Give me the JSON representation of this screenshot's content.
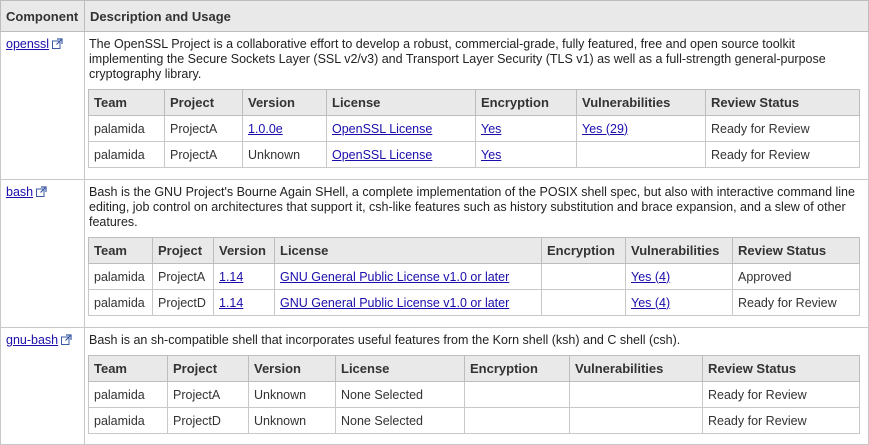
{
  "header": {
    "component": "Component",
    "description": "Description and Usage"
  },
  "inner_headers": [
    "Team",
    "Project",
    "Version",
    "License",
    "Encryption",
    "Vulnerabilities",
    "Review Status"
  ],
  "components": [
    {
      "name": "openssl",
      "description": "The OpenSSL Project is a collaborative effort to develop a robust, commercial-grade, fully featured, free and open source toolkit implementing the Secure Sockets Layer (SSL v2/v3) and Transport Layer Security (TLS v1) as well as a full-strength general-purpose cryptography library.",
      "rows": [
        {
          "team": "palamida",
          "project": "ProjectA",
          "version": "1.0.0e",
          "version_link": true,
          "license": "OpenSSL License",
          "license_link": true,
          "encryption": "Yes",
          "vulnerabilities": "Yes (29)",
          "review_status": "Ready for Review"
        },
        {
          "team": "palamida",
          "project": "ProjectA",
          "version": "Unknown",
          "version_link": false,
          "license": "OpenSSL License",
          "license_link": true,
          "encryption": "Yes",
          "vulnerabilities": "",
          "review_status": "Ready for Review"
        }
      ]
    },
    {
      "name": "bash",
      "description": "Bash is the GNU Project's Bourne Again SHell, a complete implementation of the POSIX shell spec, but also with interactive command line editing, job control on architectures that support it, csh-like features such as history substitution and brace expansion, and a slew of other features.",
      "rows": [
        {
          "team": "palamida",
          "project": "ProjectA",
          "version": "1.14",
          "version_link": true,
          "license": "GNU General Public License v1.0 or later",
          "license_link": true,
          "encryption": "",
          "vulnerabilities": "Yes (4)",
          "review_status": "Approved"
        },
        {
          "team": "palamida",
          "project": "ProjectD",
          "version": "1.14",
          "version_link": true,
          "license": "GNU General Public License v1.0 or later",
          "license_link": true,
          "encryption": "",
          "vulnerabilities": "Yes (4)",
          "review_status": "Ready for Review"
        }
      ]
    },
    {
      "name": "gnu-bash",
      "description": "Bash is an sh-compatible shell that incorporates useful features from the Korn shell (ksh) and C shell (csh).",
      "rows": [
        {
          "team": "palamida",
          "project": "ProjectA",
          "version": "Unknown",
          "version_link": false,
          "license": "None Selected",
          "license_link": false,
          "encryption": "",
          "vulnerabilities": "",
          "review_status": "Ready for Review"
        },
        {
          "team": "palamida",
          "project": "ProjectD",
          "version": "Unknown",
          "version_link": false,
          "license": "None Selected",
          "license_link": false,
          "encryption": "",
          "vulnerabilities": "",
          "review_status": "Ready for Review"
        }
      ]
    }
  ],
  "icons": {
    "external_link": "external-link-icon"
  },
  "colors": {
    "link": "#1a0dab",
    "header_bg": "#e9e9e9",
    "border": "#c8c8c8"
  }
}
